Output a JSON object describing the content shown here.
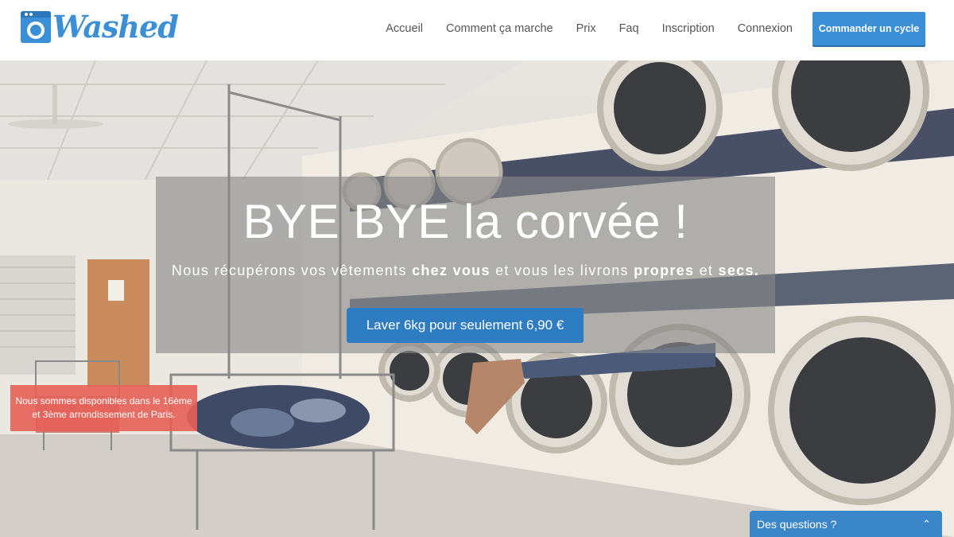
{
  "brand": {
    "name": "Washed"
  },
  "nav": {
    "items": [
      "Accueil",
      "Comment ça marche",
      "Prix",
      "Faq",
      "Inscription",
      "Connexion"
    ],
    "cta_label": "Commander un cycle"
  },
  "hero": {
    "headline": "BYE BYE la corvée !",
    "sub_part1": "Nous récupérons vos vêtements ",
    "sub_bold1": "chez vous",
    "sub_part2": " et vous les livrons ",
    "sub_bold2": "propres",
    "sub_part3": " et ",
    "sub_bold3": "secs.",
    "cta_label": "Laver 6kg pour seulement 6,90 €"
  },
  "notice": {
    "line1": "Nous sommes disponibles dans le 16ème",
    "line2": "et 3ème arrondissement de Paris."
  },
  "chat": {
    "label": "Des questions ?",
    "icon": "chevron-up-icon"
  },
  "colors": {
    "brand": "#3a8fd6",
    "hero_button": "#2e7cc2",
    "notice": "#e56058",
    "chat": "#3b86c9"
  }
}
